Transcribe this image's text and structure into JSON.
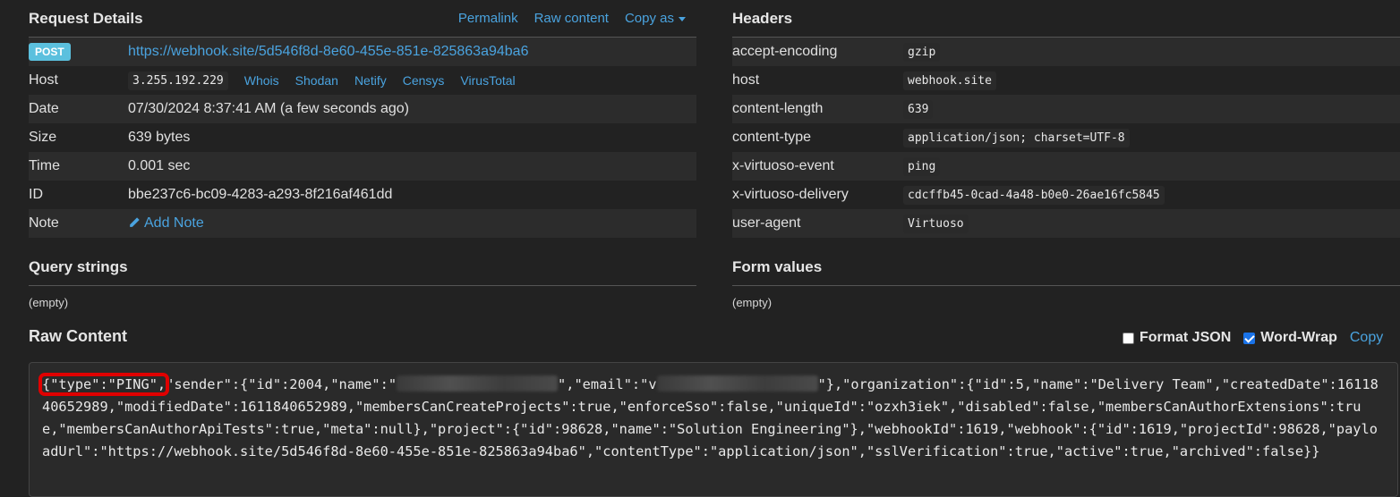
{
  "request_details": {
    "title": "Request Details",
    "permalink": "Permalink",
    "raw_content_link": "Raw content",
    "copy_as": "Copy as",
    "method": "POST",
    "url": "https://webhook.site/5d546f8d-8e60-455e-851e-825863a94ba6",
    "host_label": "Host",
    "host_value": "3.255.192.229",
    "host_links": [
      "Whois",
      "Shodan",
      "Netify",
      "Censys",
      "VirusTotal"
    ],
    "date_label": "Date",
    "date_value": "07/30/2024 8:37:41 AM (a few seconds ago)",
    "size_label": "Size",
    "size_value": "639 bytes",
    "time_label": "Time",
    "time_value": "0.001 sec",
    "id_label": "ID",
    "id_value": "bbe237c6-bc09-4283-a293-8f216af461dd",
    "note_label": "Note",
    "add_note": "Add Note"
  },
  "headers": {
    "title": "Headers",
    "rows": [
      {
        "key": "accept-encoding",
        "value": "gzip"
      },
      {
        "key": "host",
        "value": "webhook.site"
      },
      {
        "key": "content-length",
        "value": "639"
      },
      {
        "key": "content-type",
        "value": "application/json; charset=UTF-8"
      },
      {
        "key": "x-virtuoso-event",
        "value": "ping"
      },
      {
        "key": "x-virtuoso-delivery",
        "value": "cdcffb45-0cad-4a48-b0e0-26ae16fc5845"
      },
      {
        "key": "user-agent",
        "value": "Virtuoso"
      }
    ]
  },
  "query_strings": {
    "title": "Query strings",
    "value": "(empty)"
  },
  "form_values": {
    "title": "Form values",
    "value": "(empty)"
  },
  "raw": {
    "title": "Raw Content",
    "format_json": "Format JSON",
    "word_wrap": "Word-Wrap",
    "copy": "Copy",
    "part_type": "{\"type\":\"PING\",",
    "part_a": "\"sender\":{\"id\":2004,\"name\":\"",
    "part_b": "\",\"email\":\"v",
    "part_c": "\"},\"organization\":{\"id\":5,\"name\":\"Delivery Team\",\"createdDate\":1611840652989,\"modifiedDate\":1611840652989,\"membersCanCreateProjects\":true,\"enforceSso\":false,\"uniqueId\":\"ozxh3iek\",\"disabled\":false,\"membersCanAuthorExtensions\":true,\"membersCanAuthorApiTests\":true,\"meta\":null},\"project\":{\"id\":98628,\"name\":\"Solution Engineering\"},\"webhookId\":1619,\"webhook\":{\"id\":1619,\"projectId\":98628,\"payloadUrl\":\"https://webhook.site/5d546f8d-8e60-455e-851e-825863a94ba6\",\"contentType\":\"application/json\",\"sslVerification\":true,\"active\":true,\"archived\":false}}"
  }
}
